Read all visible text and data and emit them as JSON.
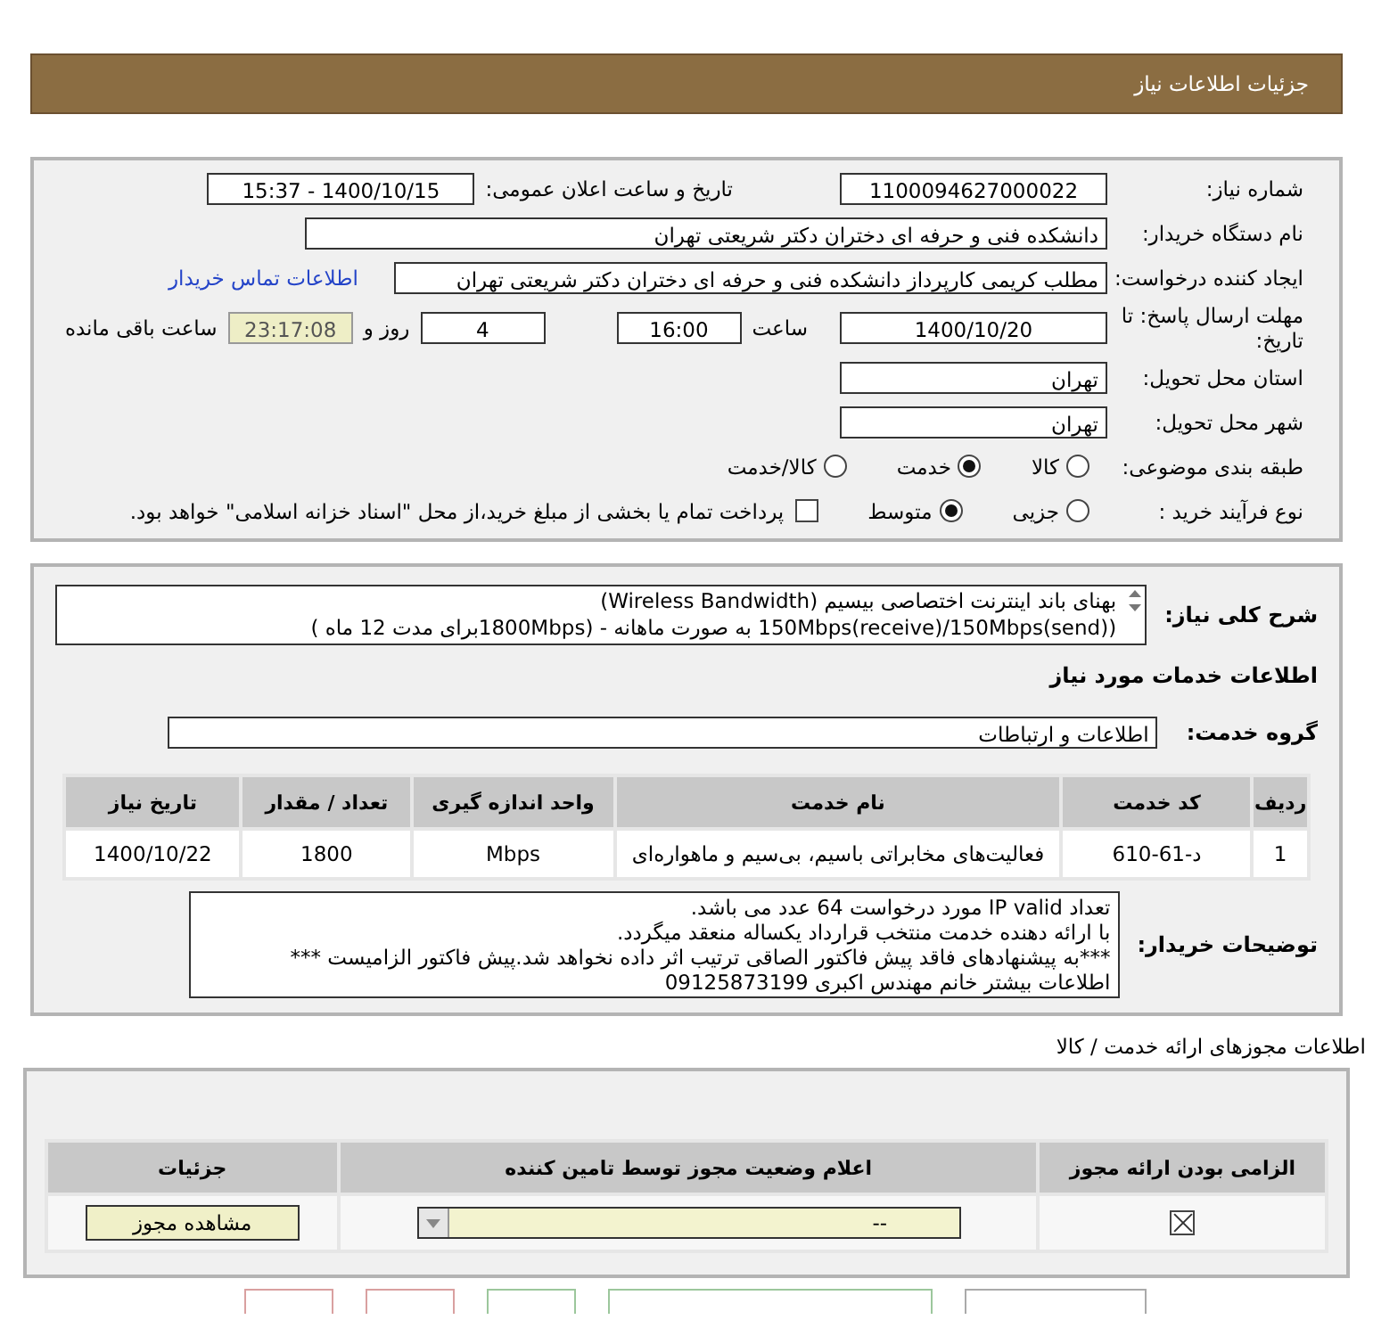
{
  "header": {
    "title": "جزئیات اطلاعات نیاز"
  },
  "details": {
    "need_number": {
      "label": "شماره نیاز:",
      "value": "1100094627000022"
    },
    "announce": {
      "label": "تاریخ و ساعت اعلان عمومی:",
      "value": "1400/10/15 - 15:37"
    },
    "buyer_org": {
      "label": "نام دستگاه خریدار:",
      "value": "دانشکده فنی و حرفه ای دختران دکتر شریعتی تهران"
    },
    "requester": {
      "label": "ایجاد کننده درخواست:",
      "value": "مطلب کریمی کارپرداز دانشکده فنی و حرفه ای دختران دکتر شریعتی تهران",
      "link": "اطلاعات تماس خریدار"
    },
    "deadline": {
      "label": "مهلت ارسال پاسخ: تا تاریخ:",
      "date": "1400/10/20",
      "time_label": "ساعت",
      "time": "16:00",
      "days": "4",
      "days_label": "روز و",
      "remaining": "23:17:08",
      "remaining_label": "ساعت باقی مانده"
    },
    "province": {
      "label": "استان محل تحویل:",
      "value": "تهران"
    },
    "city": {
      "label": "شهر محل تحویل:",
      "value": "تهران"
    },
    "category": {
      "label": "طبقه بندی موضوعی:",
      "options": [
        {
          "label": "کالا",
          "selected": false
        },
        {
          "label": "خدمت",
          "selected": true
        },
        {
          "label": "کالا/خدمت",
          "selected": false
        }
      ]
    },
    "purchase_type": {
      "label": "نوع فرآیند خرید :",
      "options": [
        {
          "label": "جزیی",
          "selected": false
        },
        {
          "label": "متوسط",
          "selected": true
        }
      ],
      "payment": {
        "label": "پرداخت تمام یا بخشی از مبلغ خرید،از محل \"اسناد خزانه اسلامی\" خواهد بود.",
        "checked": false
      }
    }
  },
  "summary": {
    "label": "شرح کلی نیاز:",
    "lines": [
      "بهنای باند اینترنت اختصاصی بیسیم (Wireless Bandwidth)",
      "(150Mbps(receive)/150Mbps(send) به صورت ماهانه - (1800Mbpsبرای مدت 12 ماه )"
    ]
  },
  "services_title": "اطلاعات خدمات مورد نیاز",
  "service_group": {
    "label": "گروه خدمت:",
    "value": "اطلاعات و ارتباطات"
  },
  "services_table": {
    "columns": [
      "ردیف",
      "کد خدمت",
      "نام خدمت",
      "واحد اندازه گیری",
      "تعداد / مقدار",
      "تاریخ نیاز"
    ],
    "rows": [
      [
        "1",
        "د-61-610",
        "فعالیت‌های مخابراتی باسیم، بی‌سیم و ماهواره‌ای",
        "Mbps",
        "1800",
        "1400/10/22"
      ]
    ]
  },
  "buyer_notes": {
    "label": "توضیحات خریدار:",
    "lines": [
      "تعداد IP valid مورد درخواست 64 عدد می باشد.",
      "با ارائه دهنده خدمت منتخب  قرارداد یکساله  منعقد میگردد.",
      "***به پیشنهادهای فاقد پیش فاکتور الصاقی ترتیب اثر داده نخواهد شد.پیش فاکتور الزامیست ***",
      "اطلاعات بیشتر خانم مهندس اکبری 09125873199"
    ]
  },
  "permits": {
    "title": "اطلاعات مجوزهای ارائه خدمت / کالا",
    "columns": [
      "الزامی بودن ارائه مجوز",
      "اعلام وضعیت مجوز توسط تامین کننده",
      "جزئیات"
    ],
    "rows": [
      {
        "required": true,
        "status": "--",
        "action": "مشاهده مجوز"
      }
    ]
  },
  "footer_buttons": [
    {
      "color": "#d9a0a0"
    },
    {
      "color": "#d9a0a0"
    },
    {
      "color": "#9cc79c"
    },
    {
      "color": "#9cc79c"
    },
    {
      "color": "#aaaaaa"
    }
  ]
}
